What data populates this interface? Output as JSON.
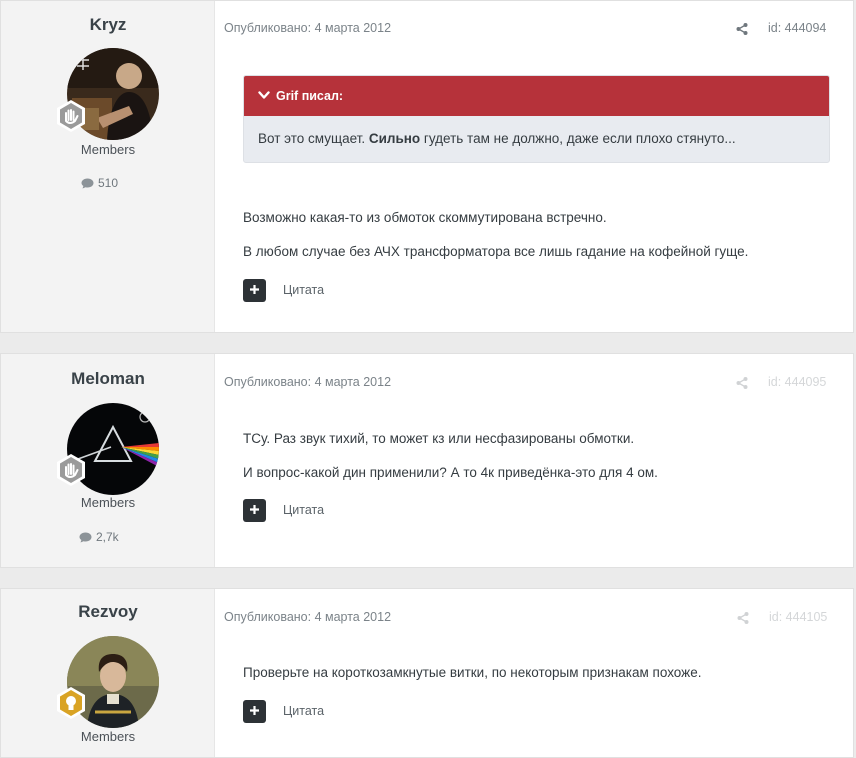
{
  "posts": [
    {
      "author": "Kryz",
      "group": "Members",
      "post_count": "510",
      "published": "Опубликовано: 4 марта 2012",
      "id_label": "id: 444094",
      "quote": {
        "header": "Grif писал:",
        "text_before": "Вот это смущает. ",
        "text_bold": "Сильно",
        "text_after": " гудеть там не должно, даже если плохо стянуто..."
      },
      "paragraphs": [
        "Возможно какая-то из обмоток скоммутирована встречно.",
        "В любом случае без АЧХ трансформатора все лишь гадание на кофейной гуще."
      ],
      "quote_button": "Цитата"
    },
    {
      "author": "Meloman",
      "group": "Members",
      "post_count": "2,7k",
      "published": "Опубликовано: 4 марта 2012",
      "id_label": "id: 444095",
      "paragraphs": [
        "ТСу. Раз звук тихий, то может кз или несфазированы обмотки.",
        "И вопрос-какой дин применили? А то 4к приведёнка-это для 4 ом."
      ],
      "quote_button": "Цитата"
    },
    {
      "author": "Rezvoy",
      "group": "Members",
      "published": "Опубликовано: 4 марта 2012",
      "id_label": "id: 444105",
      "paragraphs": [
        "Проверьте на короткозамкнутые витки, по некоторым признакам похоже."
      ],
      "quote_button": "Цитата"
    }
  ],
  "icons": {
    "share": "share-icon",
    "comment": "comment-icon",
    "plus": "plus-icon",
    "chevron": "chevron-down-icon",
    "rank_member": "hand-rank-icon",
    "rank_gold": "lightbulb-rank-icon"
  },
  "colors": {
    "quote_header": "#b6323a",
    "quote_body": "#e8ebf0",
    "page_bg": "#ebebeb",
    "author_bg": "#f3f3f3",
    "rank_gray": "#9a9a9a",
    "rank_gold": "#d9a324"
  }
}
